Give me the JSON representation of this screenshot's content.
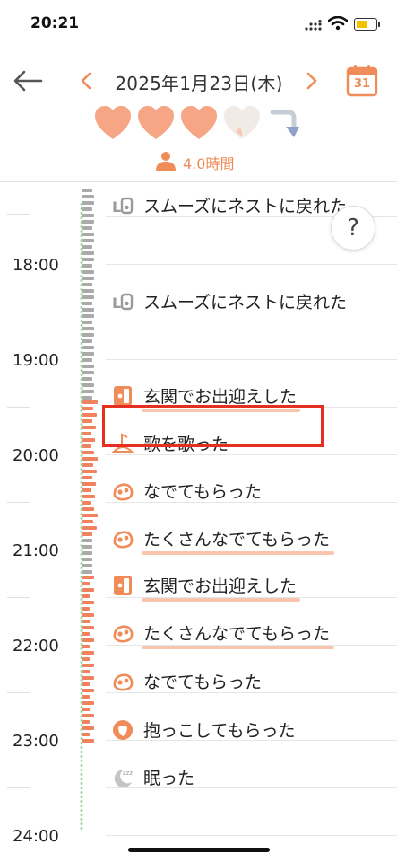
{
  "status_bar": {
    "time": "20:21"
  },
  "header": {
    "date": "2025年1月23日(木)",
    "calendar_day": "31",
    "sleep_time": "4.0時間"
  },
  "hearts": {
    "filled": 3,
    "total": 4
  },
  "colors": {
    "accent": "#f08c5a",
    "grey_bar": "#aaaaaa",
    "orange_bar": "#f0825f",
    "green_dot": "#9bd8a0",
    "highlight": "#e62e21",
    "underline": "#f9c6ad"
  },
  "timeline": {
    "hours": [
      "18:00",
      "19:00",
      "20:00",
      "21:00",
      "22:00",
      "23:00",
      "24:00"
    ],
    "events": [
      {
        "label": "スムーズにネストに戻れた",
        "icon": "nest-icon",
        "underlined": false
      },
      {
        "label": "スムーズにネストに戻れた",
        "icon": "nest-icon",
        "underlined": false
      },
      {
        "label": "玄関でお出迎えした",
        "icon": "door-icon",
        "underlined": true
      },
      {
        "label": "歌を歌った",
        "icon": "music-note-icon",
        "underlined": false,
        "highlighted": true
      },
      {
        "label": "なでてもらった",
        "icon": "pet-hand-icon",
        "underlined": false
      },
      {
        "label": "たくさんなでてもらった",
        "icon": "pet-hand-icon",
        "underlined": true
      },
      {
        "label": "玄関でお出迎えした",
        "icon": "door-icon",
        "underlined": true
      },
      {
        "label": "たくさんなでてもらった",
        "icon": "pet-hand-icon",
        "underlined": true
      },
      {
        "label": "なでてもらった",
        "icon": "pet-hand-icon",
        "underlined": false
      },
      {
        "label": "抱っこしてもらった",
        "icon": "hug-icon",
        "underlined": false
      },
      {
        "label": "眠った",
        "icon": "sleep-moon-icon",
        "underlined": false
      }
    ]
  },
  "help": {
    "label": "?"
  }
}
